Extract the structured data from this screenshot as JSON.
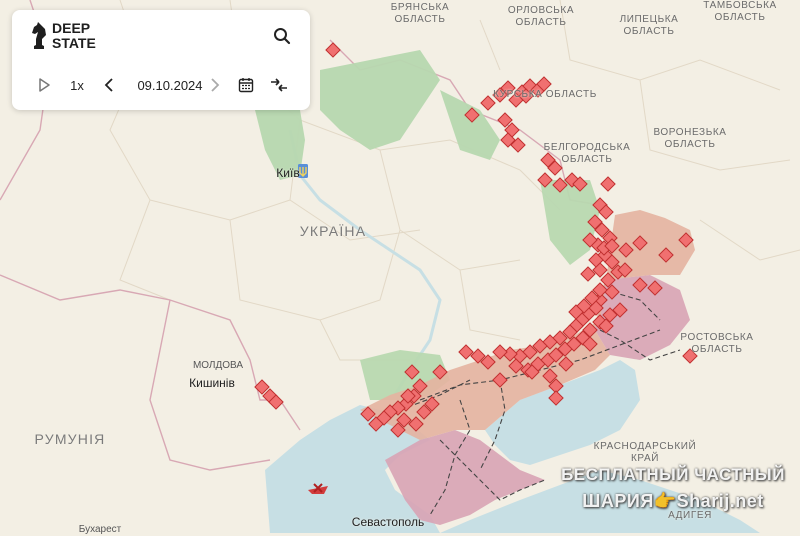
{
  "brand": {
    "line1": "DEEP",
    "line2": "STATE"
  },
  "controls": {
    "speed": "1x",
    "date": "09.10.2024",
    "play_icon": "play-icon",
    "prev_icon": "chevron-left-icon",
    "next_icon": "chevron-right-icon",
    "calendar_icon": "calendar-icon",
    "compare_icon": "compare-arrows-icon",
    "search_icon": "search-icon"
  },
  "map": {
    "colors": {
      "land": "#f3efe4",
      "sea": "#c7dfe4",
      "occupied": "#e6b6a0",
      "occupied_pre2022": "#d9a0b0",
      "liberated": "#b8d8b0",
      "marker": "#f07070",
      "marker_border": "#c03030"
    },
    "labels": {
      "bryansk": "БРЯНСЬКА ОБЛАСТЬ",
      "orlovsk": "ОРЛОВСЬКА ОБЛАСТЬ",
      "lipetsk": "ЛИПЕЦЬКА ОБЛАСТЬ",
      "tambov": "ТАМБОВСЬКА ОБЛАСТЬ",
      "kursk": "КУРСЬКА ОБЛАСТЬ",
      "belgorod": "БЕЛГОРОДСЬКА ОБЛАСТЬ",
      "voronezh": "ВОРОНЕЗЬКА ОБЛАСТЬ",
      "kyiv": "Київ",
      "ukraine": "УКРАЇНА",
      "rostov": "РОСТОВСЬКА ОБЛАСТЬ",
      "moldova": "МОЛДОВА",
      "chisinau": "Кишинів",
      "romania": "РУМУНІЯ",
      "krasnodar": "КРАСНОДАРСЬКИЙ КРАЙ",
      "adygea": "АДИГЕЯ",
      "sevastopol": "Севастополь",
      "bucharest": "Бухарест"
    }
  },
  "watermark": {
    "line1": "БЕСПЛАТНЫЙ ЧАСТНЫЙ",
    "line2": "ШАРИЯ👉Sharij.net"
  }
}
